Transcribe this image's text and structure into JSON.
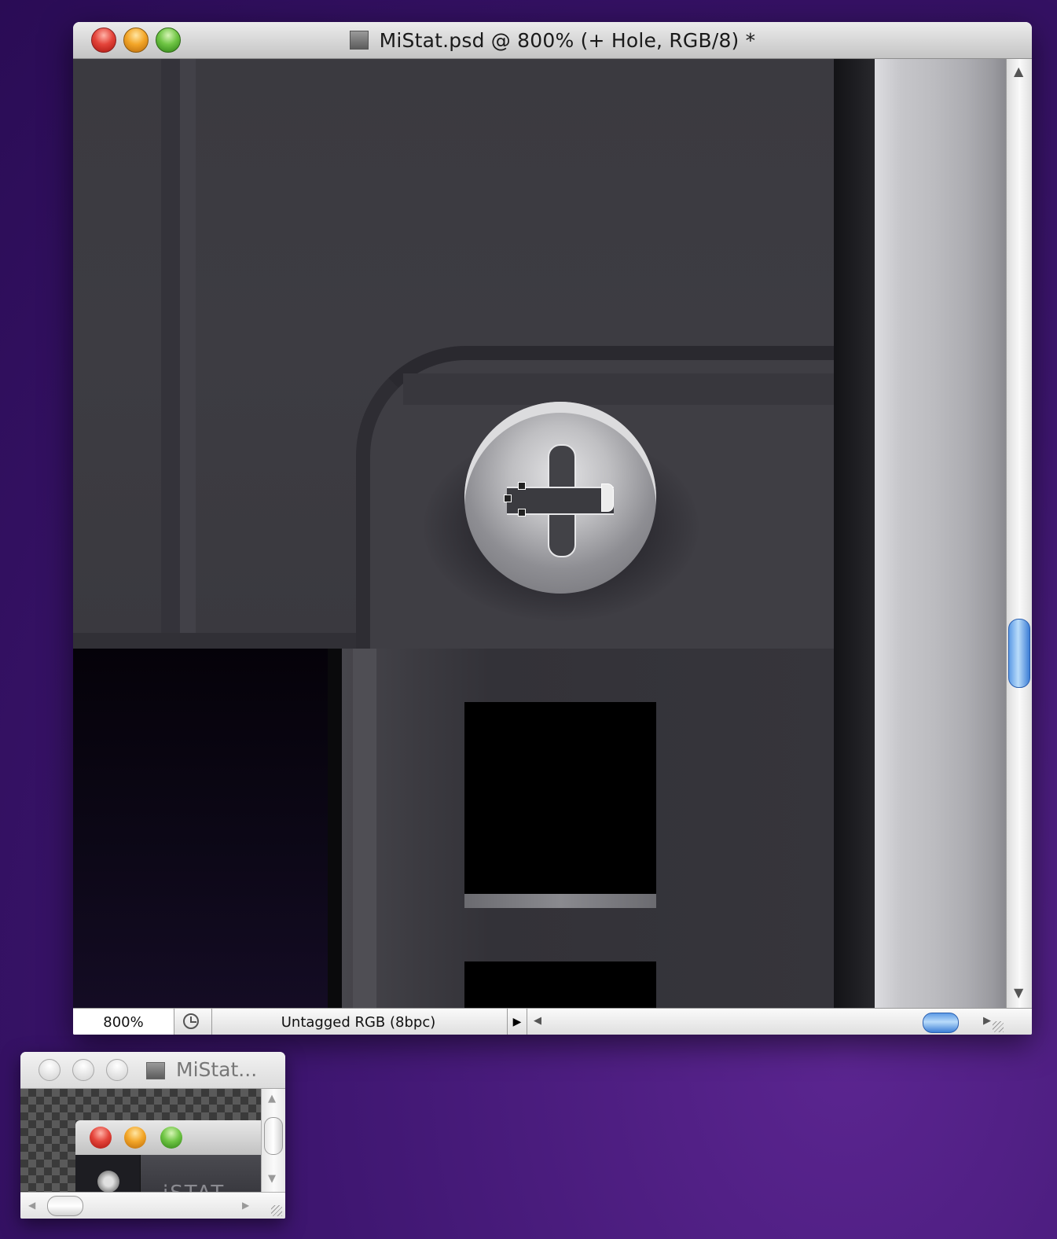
{
  "main_window": {
    "title": "MiStat.psd @ 800% (+ Hole, RGB/8) *",
    "icons": {
      "close": "close-button",
      "minimize": "minimize-button",
      "zoom": "zoom-button",
      "document": "psd-document-icon"
    },
    "status": {
      "zoom": "800%",
      "profile": "Untagged RGB (8bpc)",
      "menu_arrow": "▶"
    },
    "scrollbar": {
      "up": "▲",
      "down": "▼",
      "left": "◀",
      "right": "▶"
    }
  },
  "small_window": {
    "title": "MiStat...",
    "inner_window_text": "iSTAT",
    "scrollbar": {
      "up": "▲",
      "down": "▼",
      "left": "◀",
      "right": "▶"
    }
  },
  "colors": {
    "desktop": "#3e1670",
    "canvas_gray": "#39383e",
    "scroll_thumb": "#5d9be6"
  }
}
